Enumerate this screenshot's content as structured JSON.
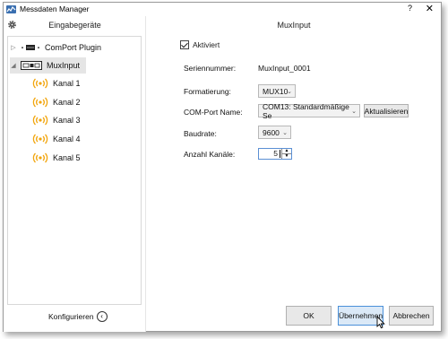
{
  "window": {
    "title": "Messdaten Manager",
    "help": "?",
    "close": "✕"
  },
  "left": {
    "title": "Eingabegeräte",
    "tree": [
      {
        "label": "ComPort Plugin",
        "expanded": false
      },
      {
        "label": "MuxInput",
        "expanded": true,
        "selected": true
      }
    ],
    "channels": [
      "Kanal 1",
      "Kanal 2",
      "Kanal 3",
      "Kanal 4",
      "Kanal 5"
    ],
    "configure_label": "Konfigurieren",
    "configure_icon": "‹"
  },
  "right": {
    "title": "MuxInput",
    "activated_label": "Aktiviert",
    "serial_label": "Seriennummer:",
    "serial_value": "MuxInput_0001",
    "format_label": "Formatierung:",
    "format_value": "MUX10",
    "port_label": "COM-Port Name:",
    "port_value": "COM13: Standardmäßige Se",
    "refresh_label": "Aktualisieren",
    "baud_label": "Baudrate:",
    "baud_value": "9600",
    "channels_label": "Anzahl Kanäle:",
    "channels_value": "5"
  },
  "buttons": {
    "ok": "OK",
    "apply": "Übernehmen",
    "cancel": "Abbrechen"
  },
  "colors": {
    "accent": "#4a90d9",
    "signal_icon": "#f2a50c"
  }
}
